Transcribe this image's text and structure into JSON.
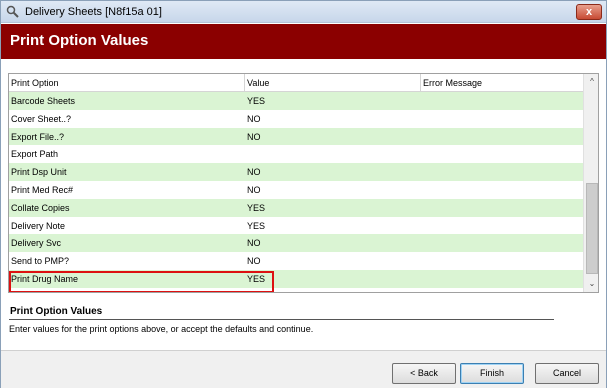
{
  "window": {
    "title": "Delivery Sheets [N8f15a 01]",
    "close_symbol": "x"
  },
  "banner": {
    "title": "Print Option Values"
  },
  "grid": {
    "columns": [
      "Print Option",
      "Value",
      "Error Message"
    ],
    "rows": [
      {
        "option": "Barcode Sheets",
        "value": "YES",
        "error": ""
      },
      {
        "option": "Cover Sheet..?",
        "value": "NO",
        "error": ""
      },
      {
        "option": "Export File..?",
        "value": "NO",
        "error": ""
      },
      {
        "option": "Export Path",
        "value": "",
        "error": ""
      },
      {
        "option": "Print Dsp Unit",
        "value": "NO",
        "error": ""
      },
      {
        "option": "Print Med Rec#",
        "value": "NO",
        "error": ""
      },
      {
        "option": "Collate Copies",
        "value": "YES",
        "error": ""
      },
      {
        "option": "Delivery Note",
        "value": "YES",
        "error": ""
      },
      {
        "option": "Delivery Svc",
        "value": "NO",
        "error": ""
      },
      {
        "option": "Send to PMP?",
        "value": "NO",
        "error": ""
      },
      {
        "option": "Print Drug Name",
        "value": "YES",
        "error": ""
      }
    ],
    "highlighted_row_index": 10
  },
  "description": {
    "title": "Print Option Values",
    "text": "Enter values for the print options above, or accept the defaults and continue."
  },
  "footer": {
    "back_label": "< Back",
    "finish_label": "Finish",
    "cancel_label": "Cancel"
  },
  "colors": {
    "banner": "#8b0000",
    "alt_row": "#daf4d3",
    "highlight": "#dd1111"
  }
}
